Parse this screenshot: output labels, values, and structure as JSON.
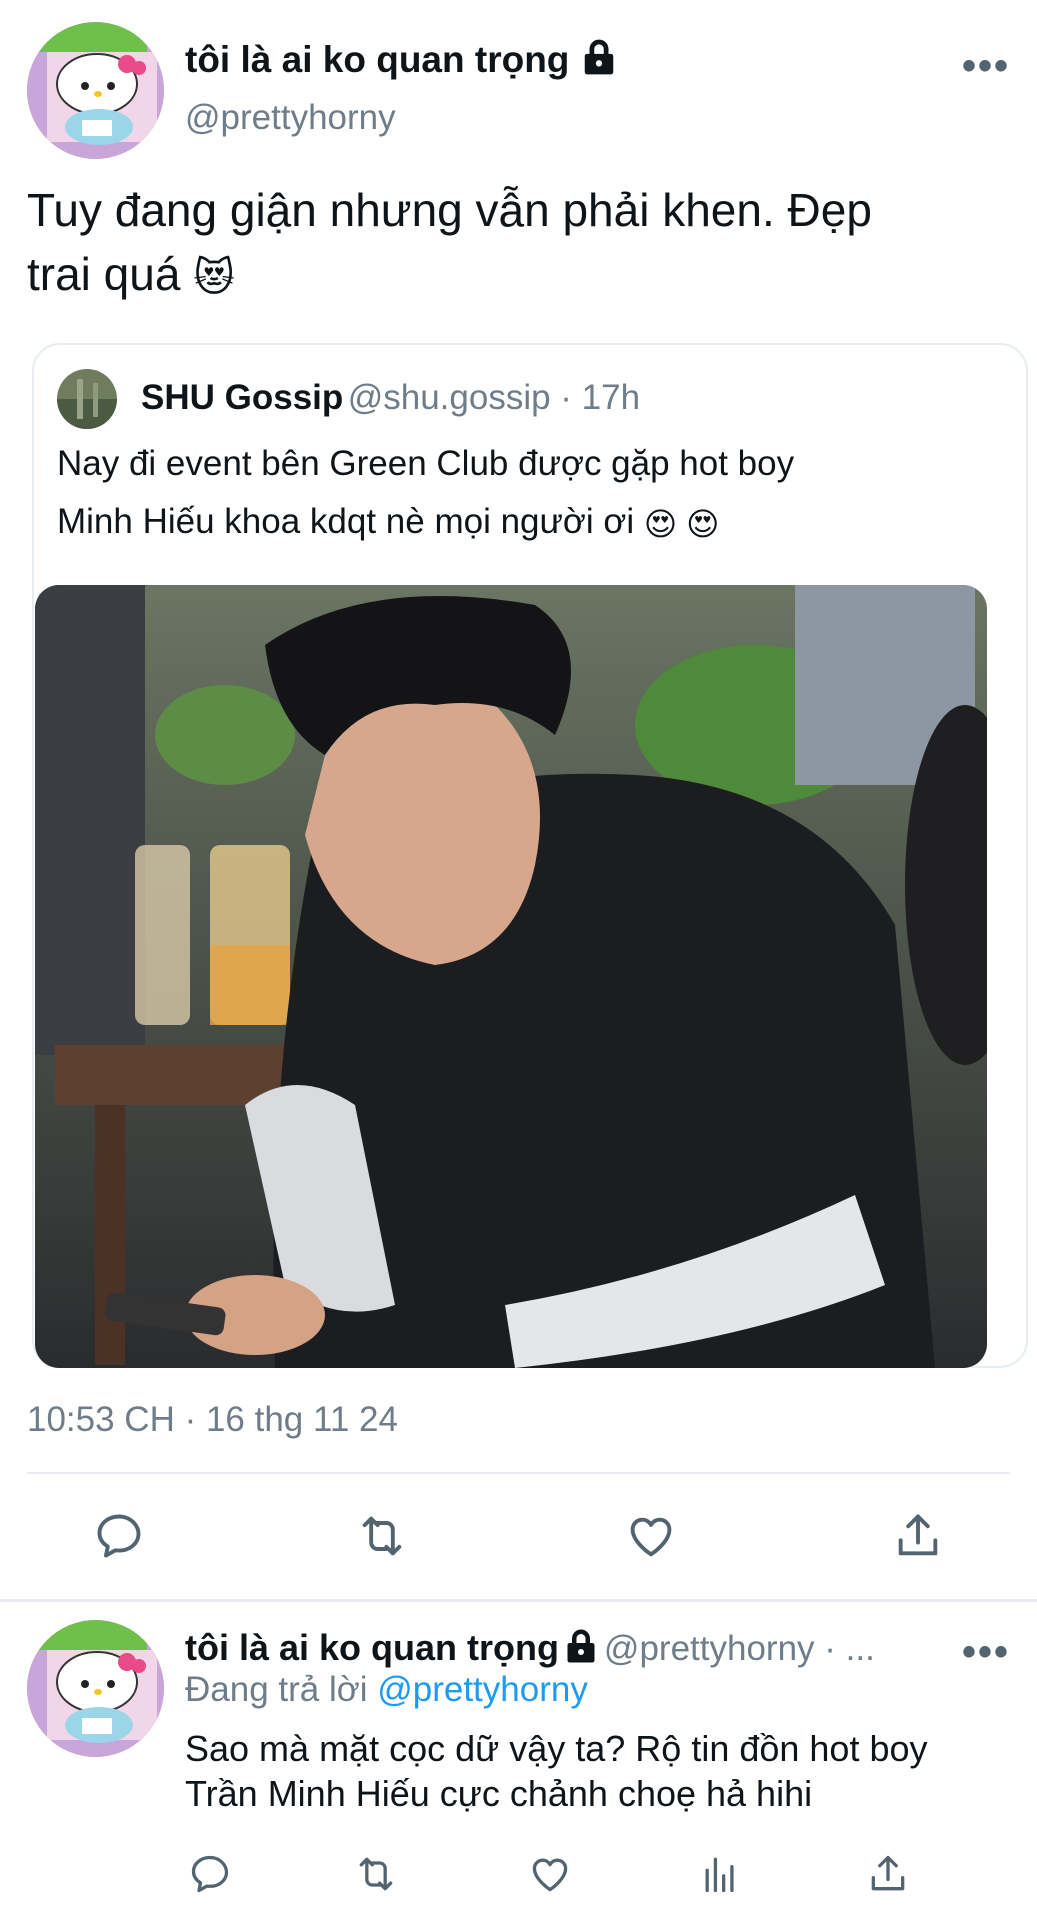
{
  "main_tweet": {
    "display_name": "tôi là ai ko quan trọng",
    "handle": "@prettyhorny",
    "more_label": "•••",
    "text_line1": "Tuy đang giận nhưng vẫn phải khen. Đẹp",
    "text_line2": "trai quá",
    "text_emoji": "😻"
  },
  "quoted_tweet": {
    "display_name": "SHU Gossip",
    "handle_time": "@shu.gossip · 17h",
    "text_line1": "Nay đi event bên Green Club được gặp hot boy",
    "text_line2": "Minh Hiếu khoa kdqt nè mọi người ơi",
    "text_emojis": "😍 😍"
  },
  "timestamp": "10:53 CH · 16 thg 11 24",
  "actions": {
    "icons": [
      "reply-icon",
      "retweet-icon",
      "like-icon",
      "share-icon"
    ]
  },
  "reply_tweet": {
    "display_name": "tôi là ai ko quan trọng",
    "handle": "@prettyhorny · ...",
    "more_label": "•••",
    "replying_prefix": "Đang trả lời",
    "replying_to": "@prettyhorny",
    "text_line1": "Sao mà mặt cọc dữ vậy ta? Rộ tin đồn hot boy",
    "text_line2": "Trần Minh Hiếu cực chảnh choẹ hả hihi",
    "icons": [
      "reply-icon",
      "retweet-icon",
      "like-icon",
      "views-icon",
      "share-icon"
    ]
  },
  "colors": {
    "text": "#0f1419",
    "secondary": "#6f7d8a",
    "link": "#1d9bf0",
    "border": "#e6ecf0"
  }
}
